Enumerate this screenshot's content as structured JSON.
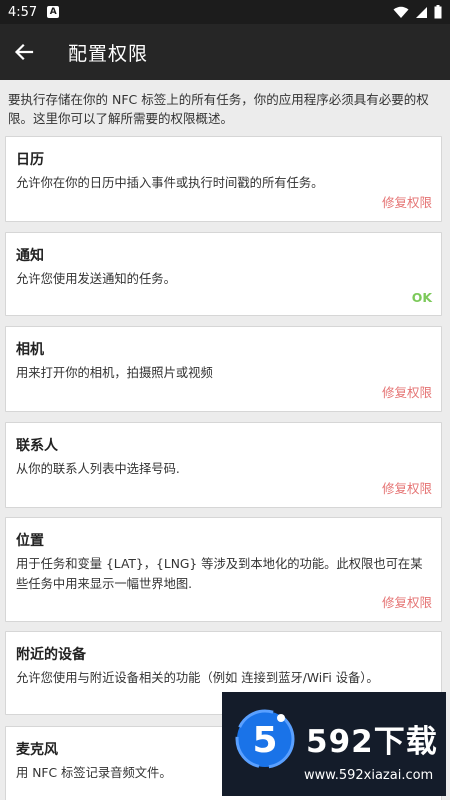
{
  "status_bar": {
    "time": "4:57",
    "notif_letter": "A"
  },
  "app_bar": {
    "title": "配置权限"
  },
  "intro": "要执行存储在你的 NFC 标签上的所有任务，你的应用程序必须具有必要的权限。这里你可以了解所需要的权限概述。",
  "cards": [
    {
      "title": "日历",
      "desc": "允许你在你的日历中插入事件或执行时间戳的所有任务。",
      "action": "修复权限"
    },
    {
      "title": "通知",
      "desc": "允许您使用发送通知的任务。",
      "action": "OK"
    },
    {
      "title": "相机",
      "desc": "用来打开你的相机，拍摄照片或视频",
      "action": "修复权限"
    },
    {
      "title": "联系人",
      "desc": "从你的联系人列表中选择号码.",
      "action": "修复权限"
    },
    {
      "title": "位置",
      "desc": "用于任务和变量 {LAT}，{LNG} 等涉及到本地化的功能。此权限也可在某些任务中用来显示一幅世界地图.",
      "action": "修复权限"
    },
    {
      "title": "附近的设备",
      "desc": "允许您使用与附近设备相关的功能（例如 连接到蓝牙/WiFi 设备）。",
      "action": ""
    },
    {
      "title": "麦克风",
      "desc": "用 NFC 标签记录音频文件。",
      "action": ""
    }
  ],
  "watermark": {
    "logo_digit": "5",
    "brand": "592下载",
    "url": "www.592xiazai.com"
  },
  "colors": {
    "status_bar": "#1c1c1c",
    "app_bar": "#262626",
    "background": "#ececec",
    "fix_action": "#e57373",
    "ok_action": "#7cc95a"
  }
}
